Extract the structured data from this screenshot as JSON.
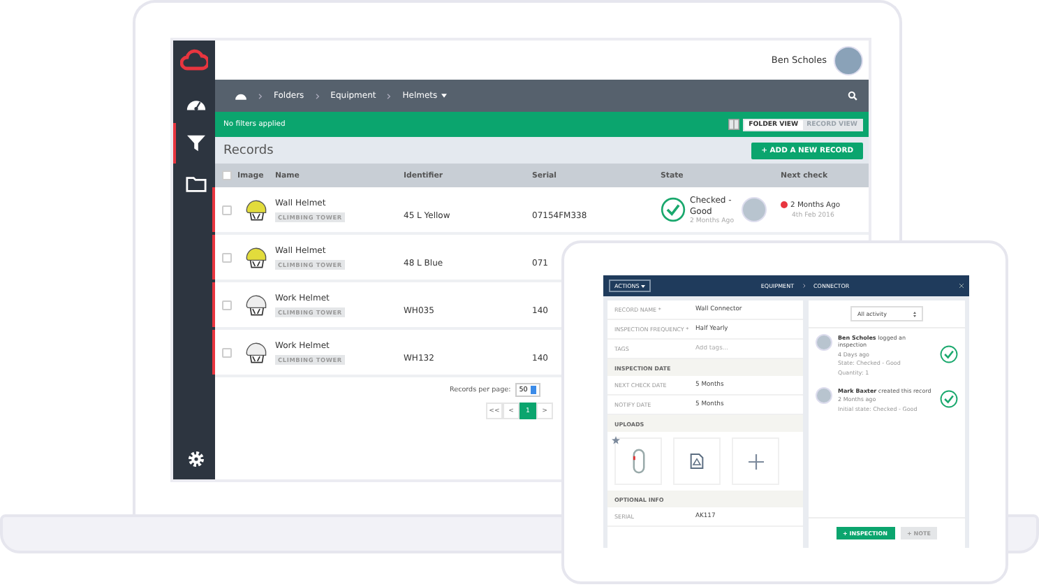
{
  "sidebar": {
    "items": [
      {
        "kind": "gauge",
        "selected": false
      },
      {
        "kind": "filter",
        "selected": true
      },
      {
        "kind": "folder",
        "selected": false
      }
    ],
    "settings": {
      "selected": false
    }
  },
  "header": {
    "user_name": "Ben Scholes"
  },
  "breadcrumbs": [
    "Folders",
    "Equipment",
    "Helmets"
  ],
  "filter_bar": {
    "text": "No filters applied",
    "views": [
      {
        "label": "FOLDER VIEW",
        "selected": true
      },
      {
        "label": "RECORD VIEW",
        "selected": false
      }
    ]
  },
  "records": {
    "title": "Records",
    "add_button": "+ ADD A NEW RECORD"
  },
  "table": {
    "select_all": {
      "checked": false
    },
    "columns": [
      "Image",
      "Name",
      "Identifier",
      "Serial",
      "State",
      "Next check"
    ],
    "rows": [
      {
        "name": "Wall Helmet",
        "tag": "CLIMBING TOWER",
        "identifier": "45 L Yellow",
        "serial": "07154FM338",
        "color": "#e2dc3c",
        "flagged": true,
        "checked": false,
        "state": {
          "label": "Checked - Good",
          "time": "2 Months Ago"
        },
        "next_check": {
          "label": "2 Months Ago",
          "date": "4th Feb 2016",
          "color": "#e8353f"
        }
      },
      {
        "name": "Wall Helmet",
        "tag": "CLIMBING TOWER",
        "identifier": "48 L Blue",
        "serial": "071",
        "color": "#e2dc3c",
        "flagged": true,
        "checked": false
      },
      {
        "name": "Work Helmet",
        "tag": "CLIMBING TOWER",
        "identifier": "WH035",
        "serial": "140",
        "color": "#eeeeee",
        "flagged": true,
        "checked": false
      },
      {
        "name": "Work Helmet",
        "tag": "CLIMBING TOWER",
        "identifier": "WH132",
        "serial": "140",
        "color": "#eeeeee",
        "flagged": true,
        "checked": false
      }
    ]
  },
  "pagination": {
    "per_page_label": "Records per page:",
    "per_page": "50",
    "pages": [
      {
        "label": "<<",
        "selected": false
      },
      {
        "label": "<",
        "selected": false
      },
      {
        "label": "1",
        "selected": true
      },
      {
        "label": ">",
        "selected": false
      }
    ]
  },
  "tablet": {
    "actions": "ACTIONS",
    "breadcrumbs": [
      "EQUIPMENT",
      "CONNECTOR"
    ],
    "fields": [
      {
        "kind": "field",
        "label": "RECORD NAME *",
        "value": "Wall Connector"
      },
      {
        "kind": "field",
        "label": "INSPECTION FREQUENCY *",
        "value": "Half Yearly"
      },
      {
        "kind": "field",
        "label": "TAGS",
        "placeholder": "Add tags..."
      },
      {
        "kind": "section",
        "label": "INSPECTION DATE"
      },
      {
        "kind": "field",
        "label": "NEXT CHECK DATE",
        "value": "5 Months"
      },
      {
        "kind": "field",
        "label": "NOTIFY DATE",
        "value": "5 Months"
      },
      {
        "kind": "section",
        "label": "UPLOADS"
      },
      {
        "kind": "uploads"
      },
      {
        "kind": "section",
        "label": "OPTIONAL INFO"
      },
      {
        "kind": "field",
        "label": "SERIAL",
        "value": "AK117"
      }
    ],
    "activity_filter": "All activity",
    "activity": [
      {
        "user": "Ben Scholes",
        "action": "logged an inspection",
        "time": "4 Days ago",
        "details": [
          "State: Checked - Good",
          "Quantity: 1"
        ]
      },
      {
        "user": "Mark Baxter",
        "action": "created this record",
        "time": "2 Months ago",
        "details": [
          "Initial state: Checked - Good"
        ]
      }
    ],
    "buttons": [
      {
        "label": "+ INSPECTION",
        "kind": "primary"
      },
      {
        "label": "+ NOTE",
        "kind": "secondary"
      }
    ]
  }
}
